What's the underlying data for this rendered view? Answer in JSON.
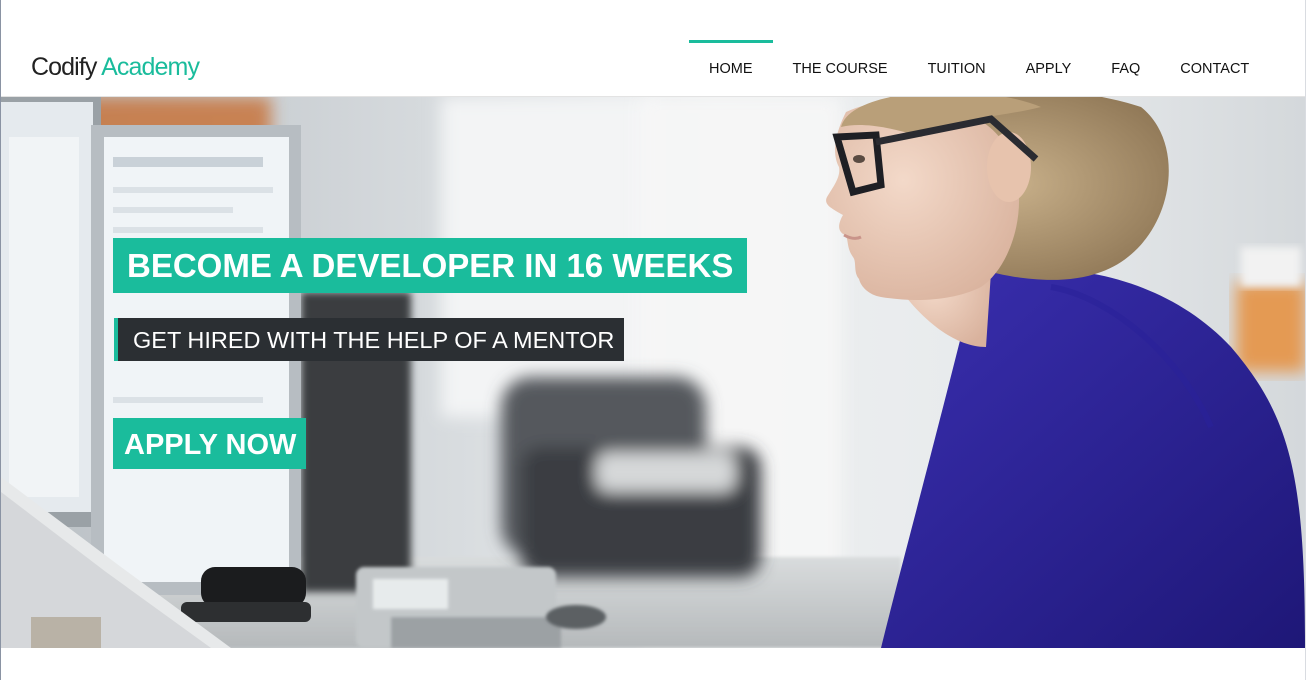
{
  "brand": {
    "logo_word1": "Codify",
    "logo_word2": "Academy",
    "accent_color": "#1abc9c"
  },
  "nav": {
    "items": [
      {
        "label": "HOME",
        "active": true
      },
      {
        "label": "THE COURSE",
        "active": false
      },
      {
        "label": "TUITION",
        "active": false
      },
      {
        "label": "APPLY",
        "active": false
      },
      {
        "label": "FAQ",
        "active": false
      },
      {
        "label": "CONTACT",
        "active": false
      }
    ]
  },
  "hero": {
    "headline": "BECOME A DEVELOPER IN 16 WEEKS",
    "subheadline": "GET HIRED WITH THE HELP OF A MENTOR",
    "cta_label": "APPLY NOW",
    "background_image": "photo of woman with glasses working at a computer in an office"
  }
}
